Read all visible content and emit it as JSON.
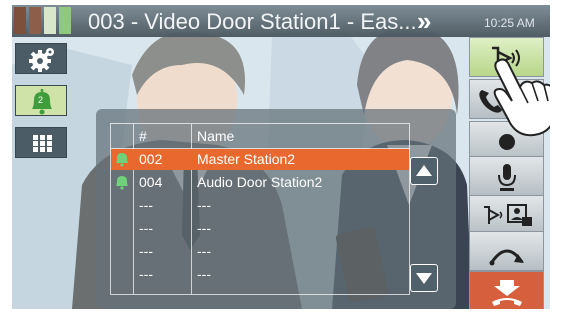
{
  "header": {
    "title": "003 - Video Door Station1 - Eas...",
    "next_label": "»",
    "time": "10:25 AM",
    "status_colors": [
      "#7a4a34",
      "#8a5a44",
      "#d8e8c8",
      "#8ec87a"
    ]
  },
  "left_toolbar": {
    "settings_icon": "gear-icon",
    "notification_icon": "bell-icon",
    "notification_count": "2",
    "keypad_icon": "keypad-icon"
  },
  "right_toolbar": [
    {
      "name": "monitor-audio-button",
      "icon": "door-speaker-icon",
      "color": "#c9e29f"
    },
    {
      "name": "call-button",
      "icon": "phone-icon",
      "color": "#cfd6da"
    },
    {
      "name": "record-button",
      "icon": "record-icon",
      "color": "#cfd6da"
    },
    {
      "name": "microphone-button",
      "icon": "microphone-icon",
      "color": "#cfd6da"
    },
    {
      "name": "transfer-button",
      "icon": "door-transfer-icon",
      "color": "#cfd6da"
    },
    {
      "name": "pan-button",
      "icon": "arc-arrow-icon",
      "color": "#cfd6da"
    },
    {
      "name": "end-call-button",
      "icon": "hang-up-icon",
      "color": "#d65f3d"
    }
  ],
  "station_list": {
    "columns": [
      "#",
      "Name"
    ],
    "rows": [
      {
        "number": "002",
        "name": "Master Station2",
        "selected": true,
        "bell": true
      },
      {
        "number": "004",
        "name": "Audio Door Station2",
        "selected": false,
        "bell": true
      },
      {
        "number": "---",
        "name": "---",
        "selected": false,
        "bell": false
      },
      {
        "number": "---",
        "name": "---",
        "selected": false,
        "bell": false
      },
      {
        "number": "---",
        "name": "---",
        "selected": false,
        "bell": false
      },
      {
        "number": "---",
        "name": "---",
        "selected": false,
        "bell": false
      }
    ],
    "scroll_up_icon": "triangle-up-icon",
    "scroll_down_icon": "triangle-down-icon"
  },
  "colors": {
    "selected_row": "#e8682e",
    "bell": "#6fd17a",
    "end_call": "#d65f3d"
  }
}
